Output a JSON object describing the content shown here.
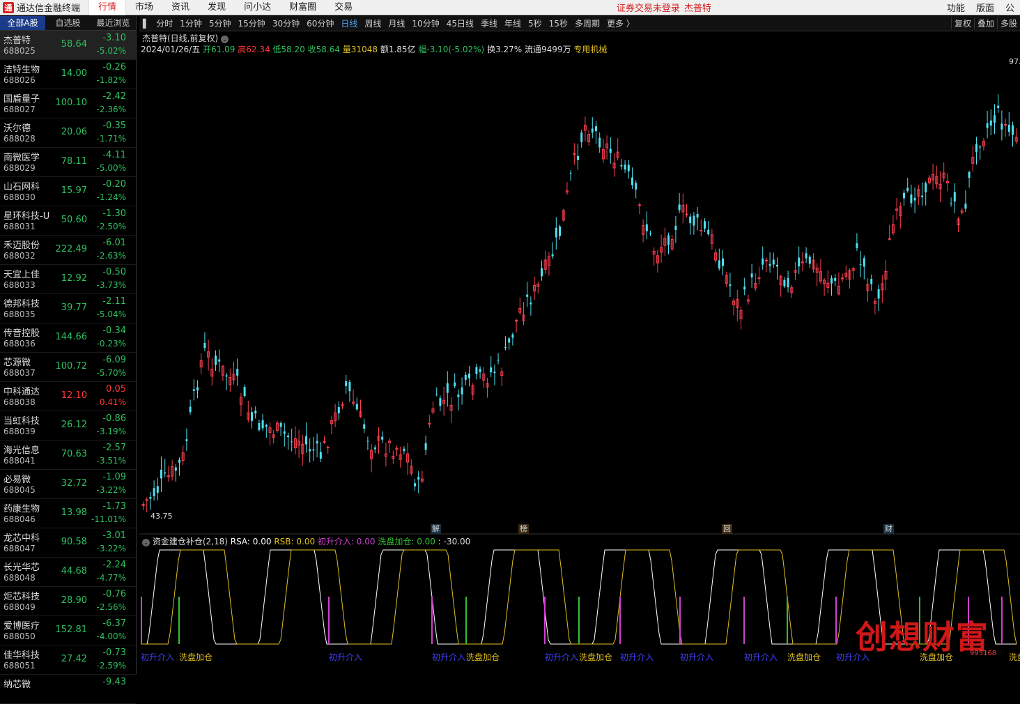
{
  "topbar": {
    "app_title": "通达信金融终端",
    "logo_glyph": "通",
    "menus": [
      "行情",
      "市场",
      "资讯",
      "发现",
      "问小达",
      "财富圈",
      "交易"
    ],
    "active_menu": "行情",
    "status_text": "证券交易未登录",
    "status_stock": "杰普特",
    "right_menus": [
      "功能",
      "版面",
      "公"
    ]
  },
  "left_tabs": [
    "全部A股",
    "自选股",
    "最近浏览"
  ],
  "stocks": [
    {
      "name": "杰普特",
      "code": "688025",
      "price": "58.64",
      "chg": "-3.10",
      "pct": "-5.02%"
    },
    {
      "name": "洁特生物",
      "code": "688026",
      "price": "14.00",
      "chg": "-0.26",
      "pct": "-1.82%"
    },
    {
      "name": "国盾量子",
      "code": "688027",
      "price": "100.10",
      "chg": "-2.42",
      "pct": "-2.36%"
    },
    {
      "name": "沃尔德",
      "code": "688028",
      "price": "20.06",
      "chg": "-0.35",
      "pct": "-1.71%"
    },
    {
      "name": "南微医学",
      "code": "688029",
      "price": "78.11",
      "chg": "-4.11",
      "pct": "-5.00%"
    },
    {
      "name": "山石网科",
      "code": "688030",
      "price": "15.97",
      "chg": "-0.20",
      "pct": "-1.24%"
    },
    {
      "name": "星环科技-U",
      "code": "688031",
      "price": "50.60",
      "chg": "-1.30",
      "pct": "-2.50%"
    },
    {
      "name": "禾迈股份",
      "code": "688032",
      "price": "222.49",
      "chg": "-6.01",
      "pct": "-2.63%"
    },
    {
      "name": "天宜上佳",
      "code": "688033",
      "price": "12.92",
      "chg": "-0.50",
      "pct": "-3.73%"
    },
    {
      "name": "德邦科技",
      "code": "688035",
      "price": "39.77",
      "chg": "-2.11",
      "pct": "-5.04%"
    },
    {
      "name": "传音控股",
      "code": "688036",
      "price": "144.66",
      "chg": "-0.34",
      "pct": "-0.23%"
    },
    {
      "name": "芯源微",
      "code": "688037",
      "price": "100.72",
      "chg": "-6.09",
      "pct": "-5.70%"
    },
    {
      "name": "中科通达",
      "code": "688038",
      "price": "12.10",
      "chg": "0.05",
      "pct": "0.41%"
    },
    {
      "name": "当虹科技",
      "code": "688039",
      "price": "26.12",
      "chg": "-0.86",
      "pct": "-3.19%"
    },
    {
      "name": "海光信息",
      "code": "688041",
      "price": "70.63",
      "chg": "-2.57",
      "pct": "-3.51%"
    },
    {
      "name": "必易微",
      "code": "688045",
      "price": "32.72",
      "chg": "-1.09",
      "pct": "-3.22%"
    },
    {
      "name": "药康生物",
      "code": "688046",
      "price": "13.98",
      "chg": "-1.73",
      "pct": "-11.01%"
    },
    {
      "name": "龙芯中科",
      "code": "688047",
      "price": "90.58",
      "chg": "-3.01",
      "pct": "-3.22%"
    },
    {
      "name": "长光华芯",
      "code": "688048",
      "price": "44.68",
      "chg": "-2.24",
      "pct": "-4.77%"
    },
    {
      "name": "炬芯科技",
      "code": "688049",
      "price": "28.90",
      "chg": "-0.76",
      "pct": "-2.56%"
    },
    {
      "name": "爱博医疗",
      "code": "688050",
      "price": "152.81",
      "chg": "-6.37",
      "pct": "-4.00%"
    },
    {
      "name": "佳华科技",
      "code": "688051",
      "price": "27.42",
      "chg": "-0.73",
      "pct": "-2.59%"
    },
    {
      "name": "纳芯微",
      "code": "",
      "price": "",
      "chg": "-9.43",
      "pct": ""
    }
  ],
  "periods": [
    "分时",
    "1分钟",
    "5分钟",
    "15分钟",
    "30分钟",
    "60分钟",
    "日线",
    "周线",
    "月线",
    "10分钟",
    "45日线",
    "季线",
    "年线",
    "5秒",
    "15秒",
    "多周期",
    "更多 〉"
  ],
  "active_period": "日线",
  "toolbar_right": [
    "复权",
    "叠加",
    "多股"
  ],
  "chart": {
    "title": "杰普特(日线,前复权)",
    "date": "2024/01/26/五",
    "open": "开61.09",
    "high": "高62.34",
    "low": "低58.20",
    "close": "收58.64",
    "volume": "量31048",
    "amount": "额1.85亿",
    "range": "幅-3.10(-5.02%)",
    "turnover": "换3.27%",
    "float": "流通9499万",
    "industry": "专用机械",
    "max_label": "97.",
    "min_label": "43.75",
    "markers": [
      {
        "text": "解",
        "color": "#40c0ff"
      },
      {
        "text": "榜",
        "color": "#ffb020"
      },
      {
        "text": "回",
        "color": "#ffb020"
      },
      {
        "text": "财",
        "color": "#40c0ff"
      }
    ],
    "colors": {
      "up": "#ff4050",
      "down": "#50e0f0"
    }
  },
  "indicator": {
    "name": "资金建仓补仓(2,18)",
    "rsa": "RSA: 0.00",
    "rsb": "RSB: 0.00",
    "cs": "初升介入: 0.00",
    "xp": "洗盘加仓: 0.00",
    "val": ": -30.00",
    "labels": [
      "初升介入",
      "洗盘加仓",
      "初升介入",
      "初升介入",
      "洗盘加仓",
      "初升介入",
      "洗盘加仓",
      "初升介入",
      "初升介入",
      "初升介入",
      "洗盘加仓",
      "初升介入",
      "洗盘加仓",
      "洗盘"
    ],
    "colors": {
      "rsa": "#ffffff",
      "rsb": "#e0c020",
      "cs": "#d040d0",
      "xp": "#30c030"
    }
  },
  "watermark": {
    "text": "创想财富",
    "sub": "995168"
  }
}
